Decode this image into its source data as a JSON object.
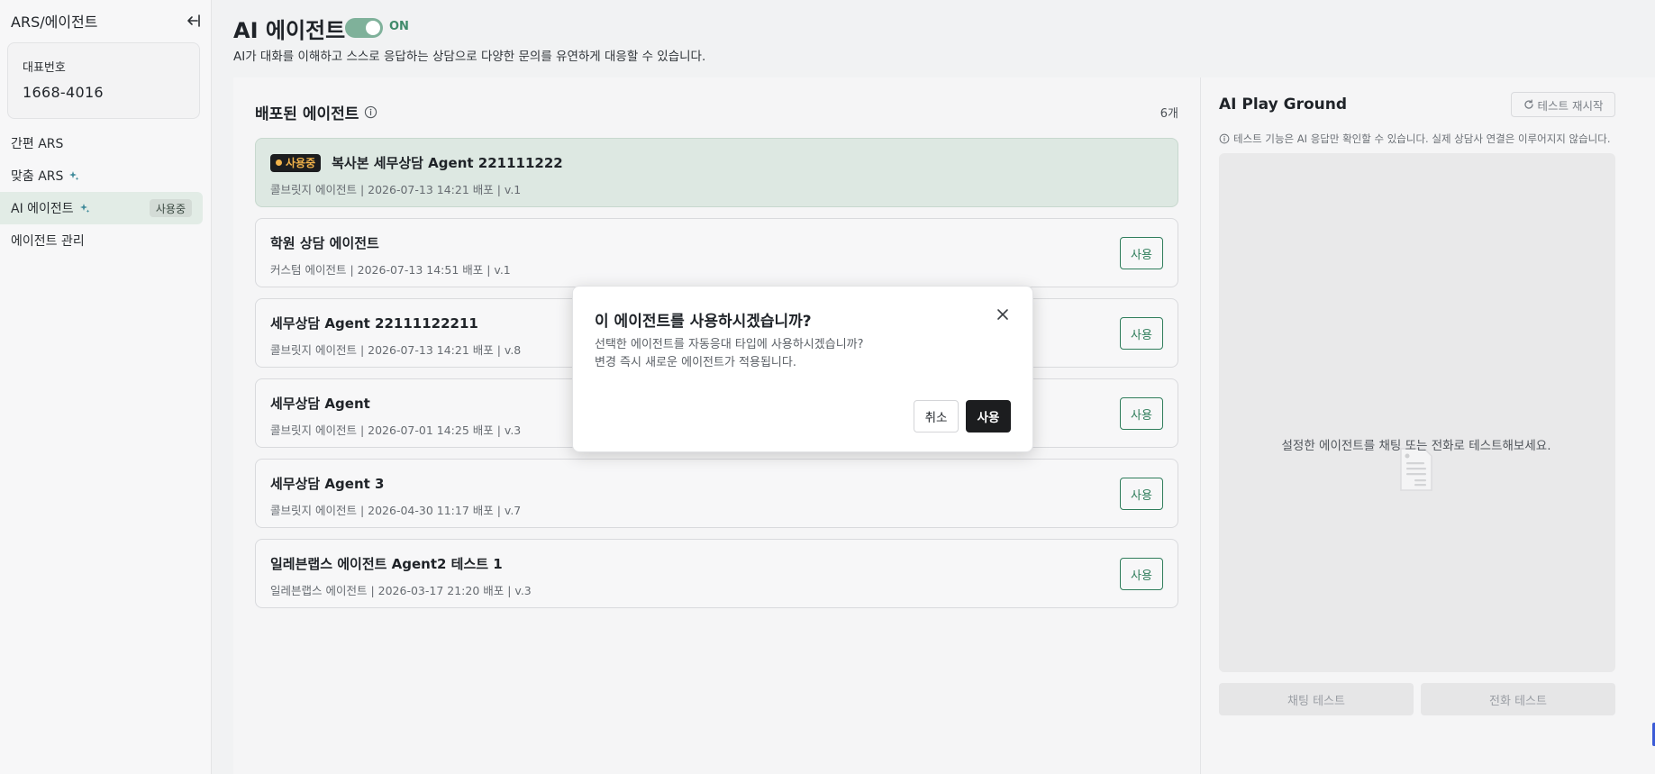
{
  "sidebar": {
    "title": "ARS/에이전트",
    "collapse_icon": "collapse-left-icon",
    "phone_card": {
      "label": "대표번호",
      "number": "1668-4016"
    },
    "items": [
      {
        "label": "간편 ARS",
        "sparkle": false,
        "badge": null,
        "active": false
      },
      {
        "label": "맞춤 ARS",
        "sparkle": true,
        "badge": null,
        "active": false
      },
      {
        "label": "AI 에이전트",
        "sparkle": true,
        "badge": "사용중",
        "active": true
      },
      {
        "label": "에이전트 관리",
        "sparkle": false,
        "badge": null,
        "active": false
      }
    ]
  },
  "header": {
    "title": "AI 에이전트",
    "toggle_label": "ON",
    "toggle_on": true,
    "description": "AI가 대화를 이해하고 스스로 응답하는 상담으로 다양한 문의를 유연하게 대응할 수 있습니다."
  },
  "deployed": {
    "title": "배포된 에이전트",
    "count": "6개",
    "inuse_label": "사용중",
    "use_label": "사용",
    "agents": [
      {
        "name": "복사본 세무상담 Agent 221111222",
        "meta": "콜브릿지 에이전트 | 2026-07-13 14:21 배포 | v.1",
        "active": true
      },
      {
        "name": "학원 상담 에이전트",
        "meta": "커스텀 에이전트 | 2026-07-13 14:51 배포 | v.1",
        "active": false
      },
      {
        "name": "세무상담 Agent 22111122211",
        "meta": "콜브릿지 에이전트 | 2026-07-13 14:21 배포 | v.8",
        "active": false
      },
      {
        "name": "세무상담 Agent",
        "meta": "콜브릿지 에이전트 | 2026-07-01 14:25 배포 | v.3",
        "active": false
      },
      {
        "name": "세무상담 Agent 3",
        "meta": "콜브릿지 에이전트 | 2026-04-30 11:17 배포 | v.7",
        "active": false
      },
      {
        "name": "일레븐랩스 에이전트 Agent2 테스트 1",
        "meta": "일레븐랩스 에이전트 | 2026-03-17 21:20 배포 | v.3",
        "active": false
      }
    ]
  },
  "playground": {
    "title": "AI Play Ground",
    "restart_label": "테스트 재시작",
    "note": "테스트 기능은 AI 응답만 확인할 수 있습니다. 실제 상담사 연결은 이루어지지 않습니다.",
    "empty_text": "설정한 에이전트를 채팅 또는 전화로 테스트해보세요.",
    "chat_test_label": "채팅 테스트",
    "call_test_label": "전화 테스트"
  },
  "modal": {
    "title": "이 에이전트를 사용하시겠습니까?",
    "body_line1": "선택한 에이전트를 자동응대 타입에 사용하시겠습니까?",
    "body_line2": "변경 즉시 새로운 에이전트가 적용됩니다.",
    "cancel_label": "취소",
    "confirm_label": "사용"
  },
  "colors": {
    "accent": "#2f7d5b",
    "toggle_on": "#7fb19a",
    "active_card": "#dde8e2",
    "inuse_badge_bg": "#1c1d1f",
    "inuse_badge_fg": "#f2b34a"
  }
}
